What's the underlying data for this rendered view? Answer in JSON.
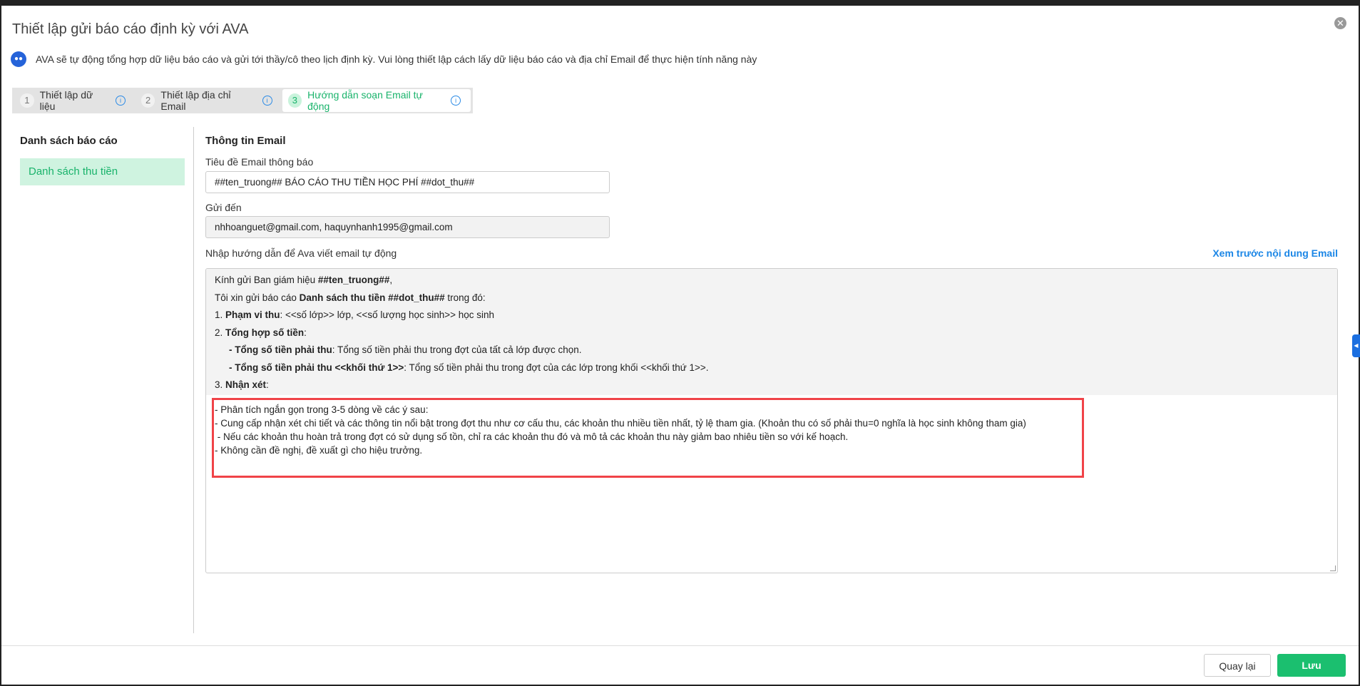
{
  "dialog": {
    "title": "Thiết lập gửi báo cáo định kỳ với AVA",
    "subtitle": "AVA sẽ tự động tổng hợp dữ liệu báo cáo và gửi tới thầy/cô theo lịch định kỳ. Vui lòng thiết lập cách lấy dữ liệu báo cáo và địa chỉ Email để thực hiện tính năng này"
  },
  "tabs": [
    {
      "num": "1",
      "label": "Thiết lập dữ liệu"
    },
    {
      "num": "2",
      "label": "Thiết lập địa chỉ Email"
    },
    {
      "num": "3",
      "label": "Hướng dẫn soạn Email tự động",
      "active": true
    }
  ],
  "sidebar": {
    "heading": "Danh sách báo cáo",
    "items": [
      {
        "label": "Danh sách thu tiền",
        "active": true
      }
    ]
  },
  "email": {
    "heading": "Thông tin Email",
    "subject_label": "Tiêu đề Email thông báo",
    "subject_value": "##ten_truong## BÁO CÁO THU TIỀN HỌC PHÍ ##dot_thu##",
    "to_label": "Gửi đến",
    "to_value": "nhhoanguet@gmail.com, haquynhanh1995@gmail.com",
    "guide_label": "Nhập hướng dẫn để Ava viết email tự động",
    "preview_link": "Xem trước nội dung Email"
  },
  "template": {
    "l1a": "Kính gửi Ban giám hiệu ",
    "l1b": "##ten_truong##",
    "l1c": ",",
    "l2a": "Tôi xin gửi báo cáo ",
    "l2b": "Danh sách thu tiền ##dot_thu##",
    "l2c": " trong đó:",
    "l3a": "1. ",
    "l3b": "Phạm vi thu",
    "l3c": ": <<số lớp>> lớp, <<số lượng học sinh>> học sinh",
    "l4a": "2. ",
    "l4b": "Tổng hợp số tiền",
    "l4c": ":",
    "l5b": "- Tổng số tiền phải thu",
    "l5c": ": Tổng số tiền phải thu trong đợt của tất cả lớp được chọn.",
    "l6b": "- Tổng số tiền phải thu <<khối thứ 1>>",
    "l6c": ": Tổng số tiền phải thu trong đợt của các lớp trong khối <<khối thứ 1>>.",
    "l7a": "3. ",
    "l7b": "Nhận xét",
    "l7c": ":"
  },
  "instructions": [
    "- Phân tích ngắn gọn trong 3-5 dòng về các ý sau:",
    "- Cung cấp nhận xét chi tiết và các thông tin nổi bật trong đợt thu như cơ cấu thu, các khoản thu nhiều tiền nhất, tỷ lệ tham gia. (Khoản thu có số phải thu=0 nghĩa là học sinh không tham gia)",
    " - Nếu các khoản thu hoàn trả trong đợt có sử dụng số tồn, chỉ ra các khoản thu đó và mô tả các khoản thu này giảm bao nhiêu tiền so với kế hoạch.",
    "- Không cần đề nghị, đề xuất gì cho hiệu trưởng."
  ],
  "footer": {
    "back": "Quay lại",
    "save": "Lưu"
  },
  "colors": {
    "accent": "#19b36b",
    "link": "#1b86e6",
    "highlight": "#f04348"
  }
}
